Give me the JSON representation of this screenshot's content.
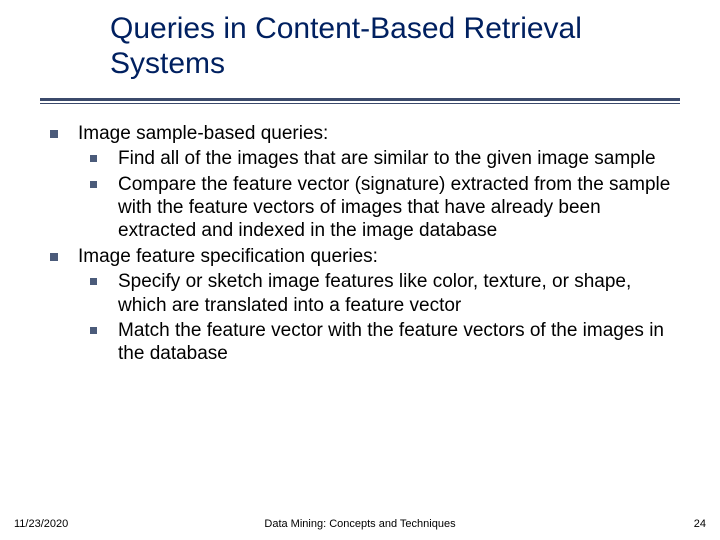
{
  "title": "Queries in Content-Based Retrieval Systems",
  "body": {
    "items": [
      {
        "text": "Image sample-based queries:",
        "sub": [
          "Find all of the images that are similar to the given image sample",
          "Compare the feature vector (signature) extracted from the sample with the feature vectors of images that have already been extracted and indexed in the image database"
        ]
      },
      {
        "text": "Image feature specification queries:",
        "sub": [
          "Specify or sketch image features like color, texture, or shape, which are translated into a feature vector",
          "Match the feature vector with the feature vectors of the images in the database"
        ]
      }
    ]
  },
  "footer": {
    "date": "11/23/2020",
    "center": "Data Mining: Concepts and Techniques",
    "page": "24"
  }
}
